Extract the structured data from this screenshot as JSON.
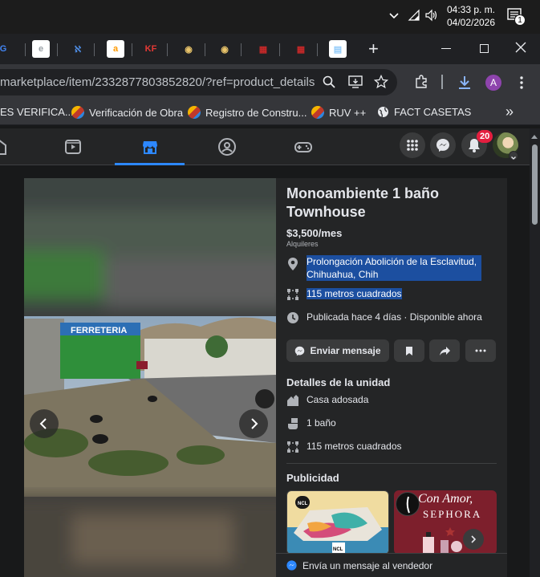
{
  "taskbar": {
    "time": "04:33 p. m.",
    "date": "04/02/2026",
    "notif_count": "1"
  },
  "tabs": {
    "new_tab": "+",
    "items": [
      {
        "icon": "google-icon",
        "glyph": "G",
        "color": "#4285f4"
      },
      {
        "icon": "site-icon",
        "glyph": "e",
        "color": "#9aa0a6"
      },
      {
        "icon": "tool-icon",
        "glyph": "ℵ",
        "color": "#4f8fe8"
      },
      {
        "icon": "amazon-icon",
        "glyph": "a",
        "color": "#ff9900"
      },
      {
        "icon": "kf-icon",
        "glyph": "KF",
        "color": "#e53935"
      },
      {
        "icon": "eye-icon",
        "glyph": "◉",
        "color": "#e9c46a"
      },
      {
        "icon": "eye-icon",
        "glyph": "◉",
        "color": "#e9c46a"
      },
      {
        "icon": "grid-red-icon",
        "glyph": "▦",
        "color": "#c62828"
      },
      {
        "icon": "grid-red-icon",
        "glyph": "▦",
        "color": "#c62828"
      },
      {
        "icon": "doc-icon",
        "glyph": "▤",
        "color": "#90caf9"
      }
    ]
  },
  "omnibar": {
    "url": "marketplace/item/2332877803852820/?ref=product_details&...",
    "profile_initial": "A"
  },
  "bookmarks": {
    "items": [
      {
        "label": "ES VERIFICA..."
      },
      {
        "label": "Verificación de Obra"
      },
      {
        "label": "Registro de Constru..."
      },
      {
        "label": "RUV ++"
      },
      {
        "label": "FACT CASETAS"
      }
    ],
    "more": "»"
  },
  "fb_nav": {
    "notif_badge": "20"
  },
  "listing": {
    "title": "Monoambiente 1 baño Townhouse",
    "price": "$3,500/mes",
    "category": "Alquileres",
    "location": "Prolongación Abolición de la Esclavitud, Chihuahua, Chih",
    "size": "115 metros cuadrados",
    "published": "Publicada hace 4 días · Disponible ahora",
    "message_button": "Enviar mensaje",
    "unit_details_heading": "Detalles de la unidad",
    "unit_type": "Casa adosada",
    "bathrooms": "1 baño",
    "unit_size": "115 metros cuadrados",
    "ads_heading": "Publicidad",
    "ad2_text_1": "Con Amor,",
    "ad2_text_2": "SEPHORA",
    "footer_message": "Envía un mensaje al vendedor"
  },
  "photo": {
    "sign_text": "FERRETERIA"
  },
  "colors": {
    "highlight": "#1c4fa0",
    "fb_blue": "#2d88ff",
    "badge_red": "#e41e3f"
  }
}
